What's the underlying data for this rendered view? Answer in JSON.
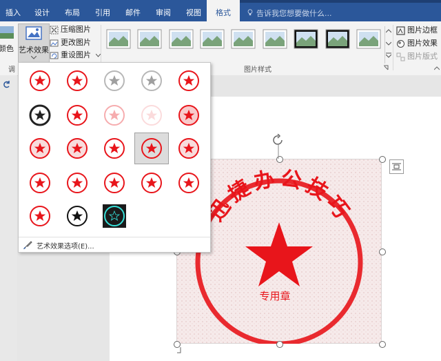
{
  "tabs": [
    {
      "label": "插入",
      "active": false
    },
    {
      "label": "设计",
      "active": false
    },
    {
      "label": "布局",
      "active": false
    },
    {
      "label": "引用",
      "active": false
    },
    {
      "label": "邮件",
      "active": false
    },
    {
      "label": "审阅",
      "active": false
    },
    {
      "label": "视图",
      "active": false
    },
    {
      "label": "格式",
      "active": true
    }
  ],
  "tell_me": "告诉我您想要做什么...",
  "ribbon": {
    "color_label": "颜色",
    "art_effects_label": "艺术效果",
    "compress_label": "压缩图片",
    "change_label": "更改图片",
    "reset_label": "重设图片",
    "adjust_group_label": "调",
    "styles_group_label": "图片样式",
    "border_label": "图片边框",
    "effects_label": "图片效果",
    "layout_label": "图片版式"
  },
  "gallery": {
    "footer_label": "艺术效果选项(E)..."
  },
  "stamp": {
    "text": "迅捷办公技巧",
    "subtext": "专用章",
    "color": "#e8151b"
  },
  "colors": {
    "ribbon_blue": "#2b579a",
    "stamp_red": "#e8151b"
  }
}
